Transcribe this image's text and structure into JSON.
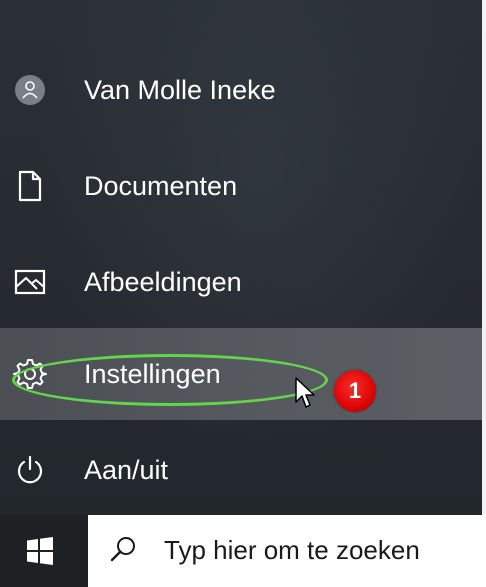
{
  "start_menu": {
    "items": [
      {
        "id": "user",
        "label": "Van Molle Ineke",
        "icon": "user-avatar-icon",
        "hovered": false
      },
      {
        "id": "documents",
        "label": "Documenten",
        "icon": "document-icon",
        "hovered": false
      },
      {
        "id": "pictures",
        "label": "Afbeeldingen",
        "icon": "pictures-icon",
        "hovered": false
      },
      {
        "id": "settings",
        "label": "Instellingen",
        "icon": "gear-icon",
        "hovered": true
      },
      {
        "id": "power",
        "label": "Aan/uit",
        "icon": "power-icon",
        "hovered": false
      }
    ]
  },
  "annotation": {
    "step_badge": "1",
    "highlight_color": "#63d44b",
    "badge_color": "#e00000"
  },
  "taskbar": {
    "start_icon": "windows-logo-icon",
    "search": {
      "icon": "search-icon",
      "placeholder": "Typ hier om te zoeken"
    }
  },
  "colors": {
    "menu_background": "#262b31",
    "hover_background": "#55595e",
    "taskbar_background": "#1e2124",
    "text": "#ffffff"
  }
}
